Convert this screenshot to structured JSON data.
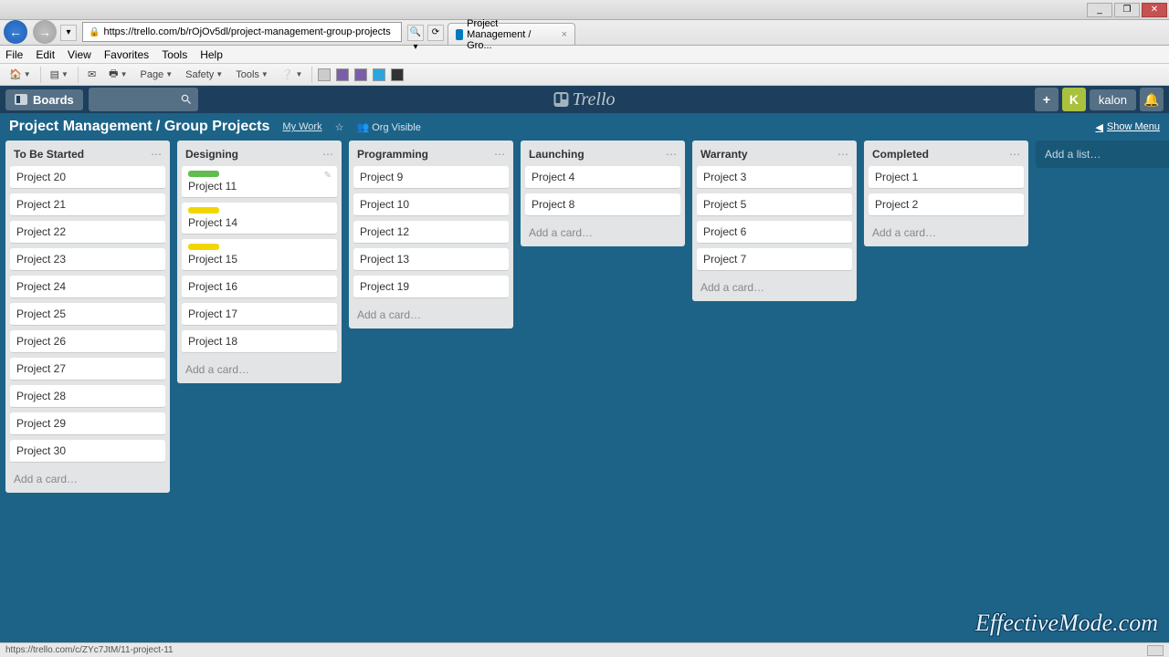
{
  "window": {
    "min": "_",
    "max": "❐",
    "close": "✕"
  },
  "browser": {
    "url": "https://trello.com/b/rOjOv5dl/project-management-group-projects",
    "tab_title": "Project Management / Gro...",
    "tab_close": "×",
    "menus": [
      "File",
      "Edit",
      "View",
      "Favorites",
      "Tools",
      "Help"
    ],
    "toolbar": [
      "Page",
      "Safety",
      "Tools"
    ],
    "search_icon": "🔍",
    "statusbar": "https://trello.com/c/ZYc7JtM/11-project-11"
  },
  "trello_header": {
    "boards": "Boards",
    "plus": "+",
    "avatar": "K",
    "user": "kalon",
    "bell": "🔔"
  },
  "board": {
    "title": "Project Management / Group Projects",
    "mywork": "My Work",
    "star": "☆",
    "visibility": "Org Visible",
    "show_menu": "Show Menu",
    "add_list": "Add a list…",
    "add_card": "Add a card…"
  },
  "lists": [
    {
      "title": "To Be Started",
      "cards": [
        {
          "t": "Project 20"
        },
        {
          "t": "Project 21"
        },
        {
          "t": "Project 22"
        },
        {
          "t": "Project 23"
        },
        {
          "t": "Project 24"
        },
        {
          "t": "Project 25"
        },
        {
          "t": "Project 26"
        },
        {
          "t": "Project 27"
        },
        {
          "t": "Project 28"
        },
        {
          "t": "Project 29"
        },
        {
          "t": "Project 30"
        }
      ]
    },
    {
      "title": "Designing",
      "cards": [
        {
          "t": "Project 11",
          "label": "green",
          "hover": true
        },
        {
          "t": "Project 14",
          "label": "yellow"
        },
        {
          "t": "Project 15",
          "label": "yellow"
        },
        {
          "t": "Project 16"
        },
        {
          "t": "Project 17"
        },
        {
          "t": "Project 18"
        }
      ]
    },
    {
      "title": "Programming",
      "cards": [
        {
          "t": "Project 9"
        },
        {
          "t": "Project 10"
        },
        {
          "t": "Project 12"
        },
        {
          "t": "Project 13"
        },
        {
          "t": "Project 19"
        }
      ]
    },
    {
      "title": "Launching",
      "cards": [
        {
          "t": "Project 4"
        },
        {
          "t": "Project 8"
        }
      ]
    },
    {
      "title": "Warranty",
      "cards": [
        {
          "t": "Project 3"
        },
        {
          "t": "Project 5"
        },
        {
          "t": "Project 6"
        },
        {
          "t": "Project 7"
        }
      ]
    },
    {
      "title": "Completed",
      "cards": [
        {
          "t": "Project 1"
        },
        {
          "t": "Project 2"
        }
      ]
    }
  ],
  "watermark": "EffectiveMode.com"
}
